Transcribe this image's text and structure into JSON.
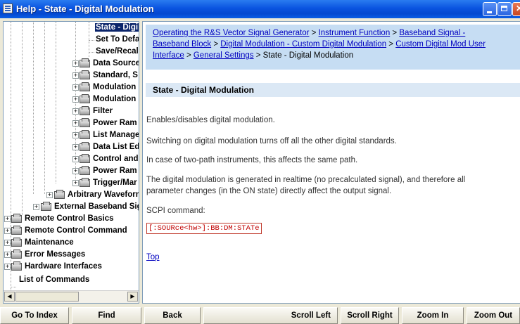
{
  "window": {
    "title": "Help - State - Digital Modulation"
  },
  "tree": {
    "items": [
      {
        "label": "State - Digi",
        "selected": true
      },
      {
        "label": "Set To Defa"
      },
      {
        "label": "Save/Recal"
      },
      {
        "label": "Data Source"
      },
      {
        "label": "Standard, S"
      },
      {
        "label": "Modulation"
      },
      {
        "label": "Modulation"
      },
      {
        "label": "Filter"
      },
      {
        "label": "Power Ram"
      },
      {
        "label": "List Manage"
      },
      {
        "label": "Data List Ed"
      },
      {
        "label": "Control and"
      },
      {
        "label": "Power Ram"
      },
      {
        "label": "Trigger/Mar"
      },
      {
        "label": "Arbitrary Waveforn"
      },
      {
        "label": "External Baseband Sig"
      },
      {
        "label": "Remote Control Basics"
      },
      {
        "label": "Remote Control Command"
      },
      {
        "label": "Maintenance"
      },
      {
        "label": "Error Messages"
      },
      {
        "label": "Hardware Interfaces"
      },
      {
        "label": "List of Commands"
      }
    ]
  },
  "content": {
    "breadcrumb": {
      "link1": "Operating the R&S Vector Signal Generator",
      "sep": " > ",
      "link2": "Instrument Function",
      "link3a": "Baseband Signal -",
      "link3b": "Baseband Block",
      "link4": "Digital Modulation - Custom Digital Modulation",
      "link5a": "Custom Digital Mod User",
      "link5b": "Interface",
      "link6": "General Settings",
      "current": "State - Digital Modulation"
    },
    "heading": "State - Digital Modulation",
    "paragraphs": [
      "Enables/disables digital modulation.",
      "Switching on digital modulation turns off all the other digital standards.",
      "In case of two-path instruments, this affects the same path.",
      "The digital modulation is generated in realtime (no precalculated signal), and therefore all",
      "parameter changes (in the ON state) directly affect the output signal.",
      "SCPI command:"
    ],
    "scpi": "[:SOURce<hw>]:BB:DM:STATe",
    "top_link": "Top"
  },
  "toolbar": {
    "go_to_index": "Go To Index",
    "find": "Find",
    "back": "Back",
    "scroll_left": "Scroll Left",
    "scroll_right": "Scroll Right",
    "zoom_in": "Zoom In",
    "zoom_out": "Zoom Out"
  }
}
